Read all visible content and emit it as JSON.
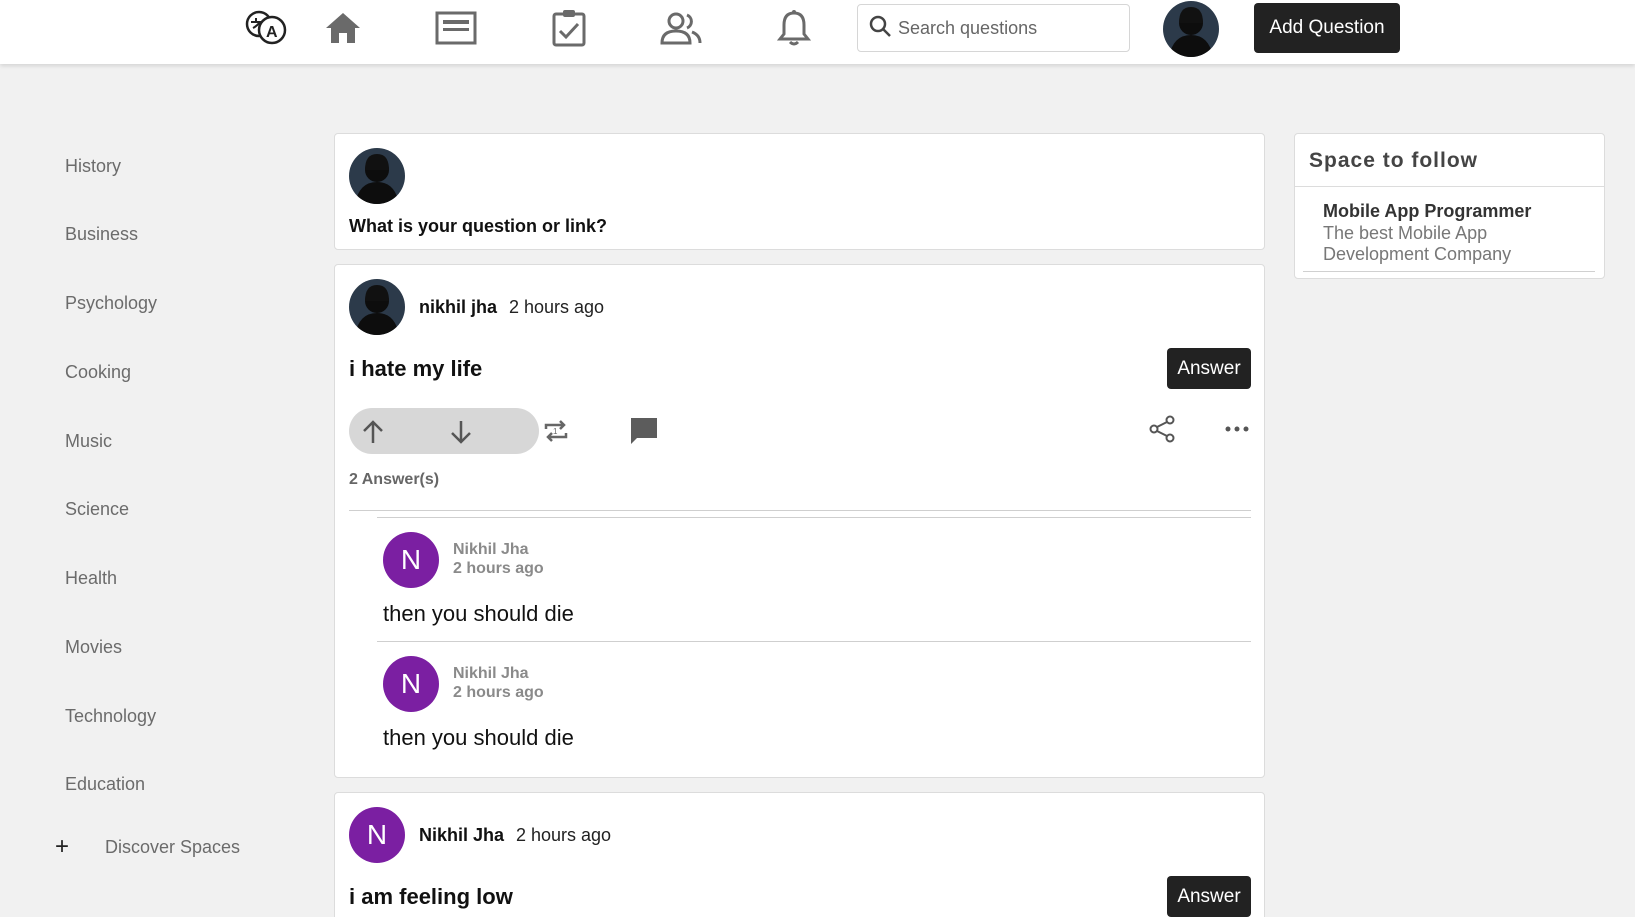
{
  "header": {
    "search_placeholder": "Search questions",
    "add_question_label": "Add Question",
    "icons": [
      "translate-icon",
      "home-icon",
      "news-icon",
      "tasks-icon",
      "people-icon",
      "bell-icon",
      "search-icon"
    ]
  },
  "sidebar": {
    "items": [
      {
        "label": "History"
      },
      {
        "label": "Business"
      },
      {
        "label": "Psychology"
      },
      {
        "label": "Cooking"
      },
      {
        "label": "Music"
      },
      {
        "label": "Science"
      },
      {
        "label": "Health"
      },
      {
        "label": "Movies"
      },
      {
        "label": "Technology"
      },
      {
        "label": "Education"
      }
    ],
    "discover_plus": "+",
    "discover_label": "Discover Spaces"
  },
  "ask_box": {
    "prompt": "What is your question or link?"
  },
  "posts": [
    {
      "author": "nikhil jha",
      "time": "2 hours ago",
      "question": "i hate my life",
      "answer_label": "Answer",
      "answer_count": "2 Answer(s)",
      "answers": [
        {
          "initial": "N",
          "name": "Nikhil Jha",
          "time": "2 hours ago",
          "text": "then you should die"
        },
        {
          "initial": "N",
          "name": "Nikhil Jha",
          "time": "2 hours ago",
          "text": "then you should die"
        }
      ]
    },
    {
      "author_initial": "N",
      "author": "Nikhil Jha",
      "time": "2 hours ago",
      "question": "i am feeling low",
      "answer_label": "Answer"
    }
  ],
  "widget": {
    "title": "Space to follow",
    "space_name": "Mobile App Programmer",
    "space_desc": "The best Mobile App Development Company"
  },
  "colors": {
    "accent_dark": "#222222",
    "letter_avatar": "#7b1fa2",
    "page_bg": "#f1f1f1"
  }
}
